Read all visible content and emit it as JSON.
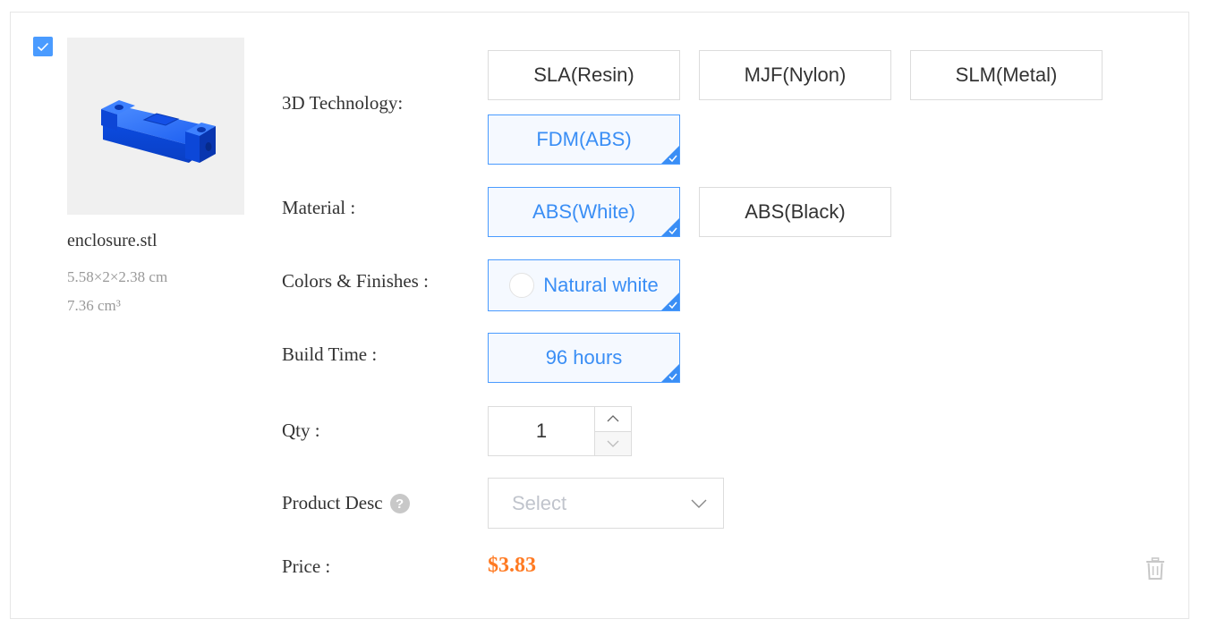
{
  "file": {
    "name": "enclosure.stl",
    "dimensions": "5.58×2×2.38 cm",
    "volume": "7.36 cm³",
    "selected": true,
    "thumbnail_color": "#1565f5"
  },
  "labels": {
    "technology": "3D Technology:",
    "material": "Material :",
    "finish": "Colors & Finishes :",
    "build_time": "Build Time :",
    "qty": "Qty :",
    "product_desc": "Product Desc",
    "price": "Price :"
  },
  "technology": {
    "options": [
      "SLA(Resin)",
      "MJF(Nylon)",
      "SLM(Metal)",
      "FDM(ABS)"
    ],
    "selected": "FDM(ABS)"
  },
  "material": {
    "options": [
      "ABS(White)",
      "ABS(Black)"
    ],
    "selected": "ABS(White)"
  },
  "finish": {
    "options": [
      "Natural white"
    ],
    "selected": "Natural white",
    "swatch_color": "#ffffff"
  },
  "build_time": {
    "options": [
      "96 hours"
    ],
    "selected": "96 hours"
  },
  "qty": {
    "value": "1"
  },
  "product_desc": {
    "placeholder": "Select",
    "help_icon": "?"
  },
  "price": {
    "value": "$3.83",
    "color": "#ff7a22"
  },
  "colors": {
    "accent": "#3a8ef5",
    "checkbox": "#4a9bff",
    "border": "#dcdcdc"
  }
}
